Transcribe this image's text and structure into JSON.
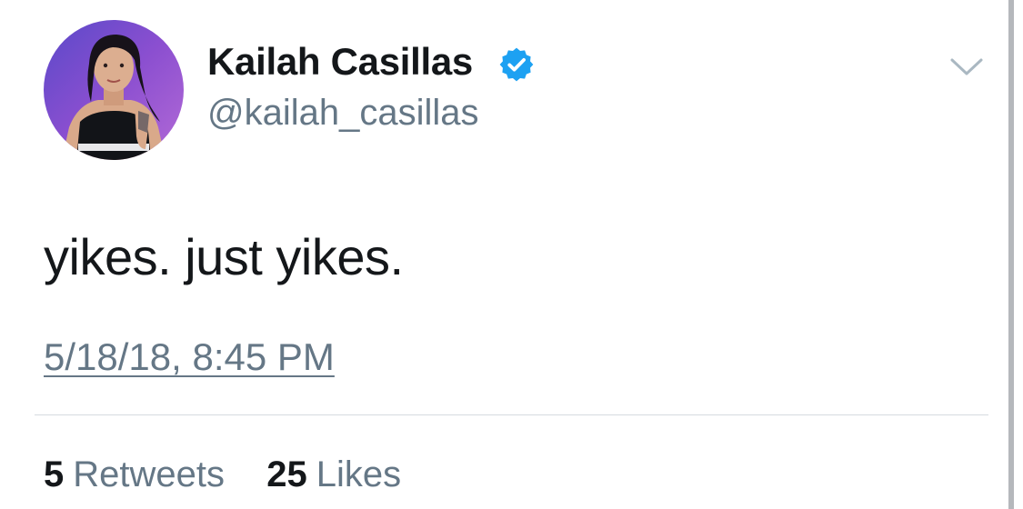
{
  "tweet": {
    "display_name": "Kailah Casillas",
    "handle": "@kailah_casillas",
    "verified": true,
    "text": "yikes. just yikes.",
    "timestamp": "5/18/18, 8:45 PM",
    "retweets": {
      "count": "5",
      "label": "Retweets"
    },
    "likes": {
      "count": "25",
      "label": "Likes"
    }
  },
  "icons": {
    "verified": "verified-badge-icon",
    "menu": "chevron-down-icon"
  },
  "colors": {
    "verified_blue": "#1da1f2",
    "text_primary": "#14171a",
    "text_secondary": "#657786",
    "divider": "#d6dbe0"
  }
}
